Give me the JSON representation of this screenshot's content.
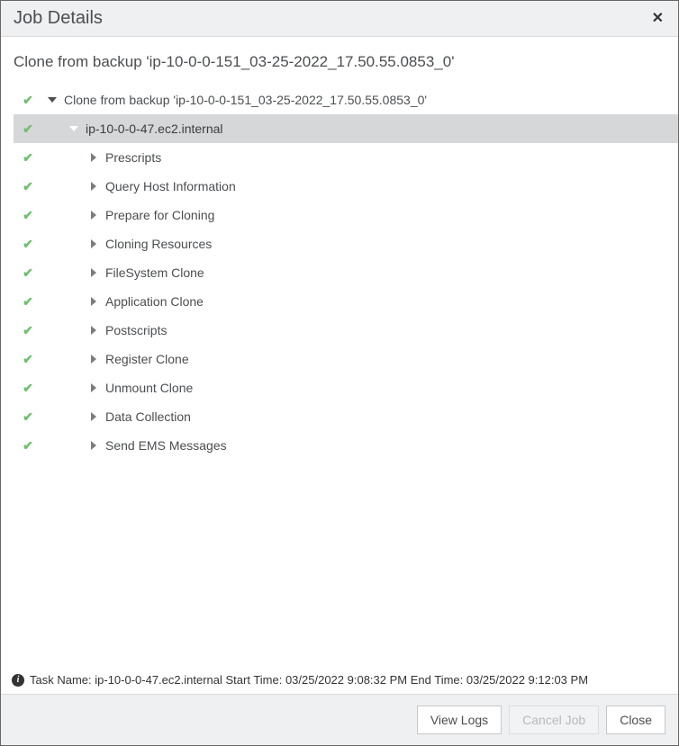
{
  "dialog": {
    "title": "Job Details",
    "subtitle": "Clone from backup 'ip-10-0-0-151_03-25-2022_17.50.55.0853_0'"
  },
  "tree": {
    "root": {
      "label": "Clone from backup 'ip-10-0-0-151_03-25-2022_17.50.55.0853_0'",
      "status": "ok",
      "expanded": true
    },
    "host": {
      "label": "ip-10-0-0-47.ec2.internal",
      "status": "ok",
      "expanded": true,
      "selected": true
    },
    "steps": [
      {
        "label": "Prescripts",
        "status": "ok",
        "expanded": false
      },
      {
        "label": "Query Host Information",
        "status": "ok",
        "expanded": false
      },
      {
        "label": "Prepare for Cloning",
        "status": "ok",
        "expanded": false
      },
      {
        "label": "Cloning Resources",
        "status": "ok",
        "expanded": false
      },
      {
        "label": "FileSystem Clone",
        "status": "ok",
        "expanded": false
      },
      {
        "label": "Application Clone",
        "status": "ok",
        "expanded": false
      },
      {
        "label": "Postscripts",
        "status": "ok",
        "expanded": false
      },
      {
        "label": "Register Clone",
        "status": "ok",
        "expanded": false
      },
      {
        "label": "Unmount Clone",
        "status": "ok",
        "expanded": false
      },
      {
        "label": "Data Collection",
        "status": "ok",
        "expanded": false
      },
      {
        "label": "Send EMS Messages",
        "status": "ok",
        "expanded": false
      }
    ]
  },
  "statusbar": {
    "text": "Task Name: ip-10-0-0-47.ec2.internal Start Time: 03/25/2022 9:08:32 PM End Time: 03/25/2022 9:12:03 PM"
  },
  "footer": {
    "view_logs_label": "View Logs",
    "cancel_job_label": "Cancel Job",
    "close_label": "Close",
    "cancel_job_enabled": false
  }
}
